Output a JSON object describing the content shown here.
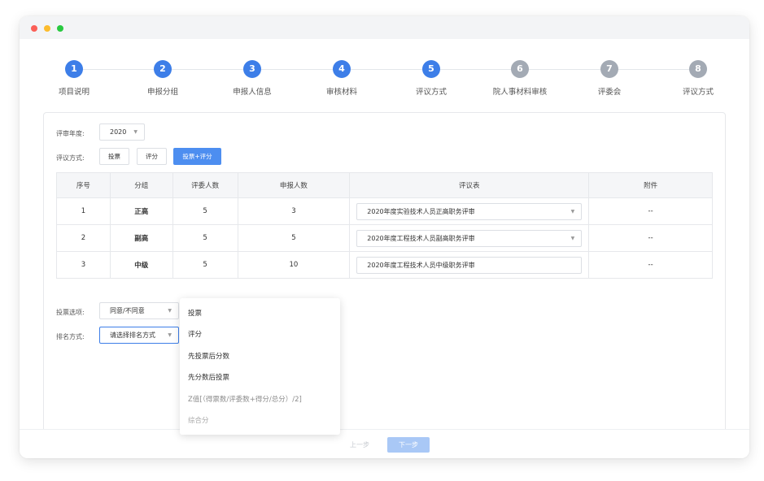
{
  "window": {
    "controls": [
      "red",
      "yellow",
      "green"
    ]
  },
  "steps": [
    {
      "number": "1",
      "label": "项目说明",
      "state": "active"
    },
    {
      "number": "2",
      "label": "申报分组",
      "state": "active"
    },
    {
      "number": "3",
      "label": "申报人信息",
      "state": "active"
    },
    {
      "number": "4",
      "label": "审核材料",
      "state": "active"
    },
    {
      "number": "5",
      "label": "评议方式",
      "state": "active"
    },
    {
      "number": "6",
      "label": "院人事材料审核",
      "state": "inactive"
    },
    {
      "number": "7",
      "label": "评委会",
      "state": "inactive"
    },
    {
      "number": "8",
      "label": "评议方式",
      "state": "inactive"
    }
  ],
  "form": {
    "year_label": "评审年度:",
    "year_value": "2020",
    "method_label": "评议方式:",
    "methods": [
      {
        "label": "投票",
        "active": false
      },
      {
        "label": "评分",
        "active": false
      },
      {
        "label": "投票+评分",
        "active": true
      }
    ],
    "vote_option_label": "投票选项:",
    "vote_option_value": "同意/不同意",
    "rank_label": "排名方式:",
    "rank_placeholder": "请选择排名方式"
  },
  "table": {
    "headers": [
      "序号",
      "分组",
      "评委人数",
      "申报人数",
      "评议表",
      "附件"
    ],
    "rows": [
      {
        "index": "1",
        "group": "正高",
        "judges": "5",
        "applicants": "3",
        "form": "2020年度实验技术人员正高职务评审",
        "has_caret": true,
        "attachment": "--"
      },
      {
        "index": "2",
        "group": "副高",
        "judges": "5",
        "applicants": "5",
        "form": "2020年度工程技术人员副高职务评审",
        "has_caret": true,
        "attachment": "--"
      },
      {
        "index": "3",
        "group": "中级",
        "judges": "5",
        "applicants": "10",
        "form": "2020年度工程技术人员中级职务评审",
        "has_caret": false,
        "attachment": "--"
      }
    ]
  },
  "dropdown": {
    "items": [
      {
        "label": "投票",
        "style": "normal"
      },
      {
        "label": "评分",
        "style": "normal"
      },
      {
        "label": "先投票后分数",
        "style": "normal"
      },
      {
        "label": "先分数后投票",
        "style": "normal"
      },
      {
        "label": "Z值[（得票数/评委数+得分/总分）/2]",
        "style": "muted"
      },
      {
        "label": "综合分",
        "style": "faded"
      }
    ]
  },
  "footer": {
    "prev_label": "上一步",
    "next_label": "下一步"
  },
  "colors": {
    "accent": "#3d7ee8",
    "inactive_step": "#a3aab4"
  }
}
